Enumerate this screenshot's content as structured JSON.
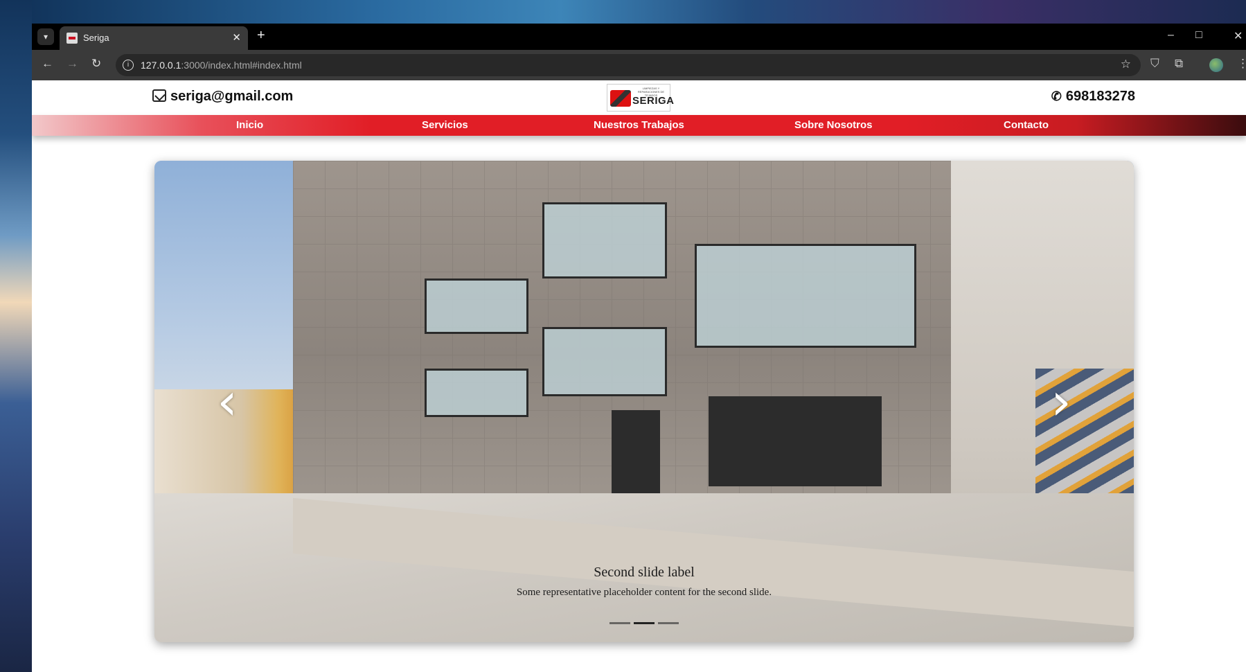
{
  "browser": {
    "tab_title": "Seriga",
    "close_glyph": "✕",
    "new_tab_glyph": "+",
    "url_host": "127.0.0.1",
    "url_rest": ":3000/index.html#index.html",
    "window_minimize": "–",
    "window_maximize": "□",
    "window_close": "✕"
  },
  "header": {
    "email": "seriga@gmail.com",
    "phone": "698183278",
    "logo_text": "SERIGA",
    "logo_tagline": "LIMPIEZAS Y REPARACIONES DE TEJADOS"
  },
  "nav": {
    "items": [
      "Inicio",
      "Servicios",
      "Nuestros Trabajos",
      "Sobre Nosotros",
      "Contacto"
    ]
  },
  "carousel": {
    "prev_glyph": "‹",
    "next_glyph": "›",
    "caption_title": "Second slide label",
    "caption_text": "Some representative placeholder content for the second slide.",
    "slide_count": 3,
    "active_index": 1
  },
  "colors": {
    "nav_red": "#e11e26",
    "browser_dark": "#3a3a3a"
  }
}
